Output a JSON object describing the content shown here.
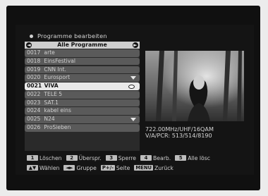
{
  "title": "Programme bearbeiten",
  "list": {
    "header": "Alle Programme",
    "rows": [
      {
        "number": "0017",
        "name": "arte",
        "selected": false
      },
      {
        "number": "0018",
        "name": "EinsFestival",
        "selected": false
      },
      {
        "number": "0019",
        "name": "CNN Int.",
        "selected": false
      },
      {
        "number": "0020",
        "name": "Eurosport",
        "selected": false
      },
      {
        "number": "0021",
        "name": "VIVA",
        "selected": true
      },
      {
        "number": "0022",
        "name": "TELE 5",
        "selected": false
      },
      {
        "number": "0023",
        "name": "SAT.1",
        "selected": false
      },
      {
        "number": "0024",
        "name": "kabel eins",
        "selected": false
      },
      {
        "number": "0025",
        "name": "N24",
        "selected": false
      },
      {
        "number": "0026",
        "name": "ProSieben",
        "selected": false
      }
    ]
  },
  "preview": {
    "frequency": "722.00MHz/UHF/16QAM",
    "pids": "V/A/PCR: 513/514/8190"
  },
  "legend": {
    "row1": [
      {
        "key": "1",
        "label": "Löschen"
      },
      {
        "key": "2",
        "label": "Überspr."
      },
      {
        "key": "3",
        "label": "Sperre"
      },
      {
        "key": "4",
        "label": "Bearb."
      },
      {
        "key": "5",
        "label": "Alle lösc"
      }
    ],
    "row2": [
      {
        "key": "▲▼",
        "label": "Wählen"
      },
      {
        "key": "◄►",
        "label": "Gruppe"
      },
      {
        "key": "P+/-",
        "label": "Seite"
      },
      {
        "key": "MENU",
        "label": "Zurück"
      }
    ]
  }
}
